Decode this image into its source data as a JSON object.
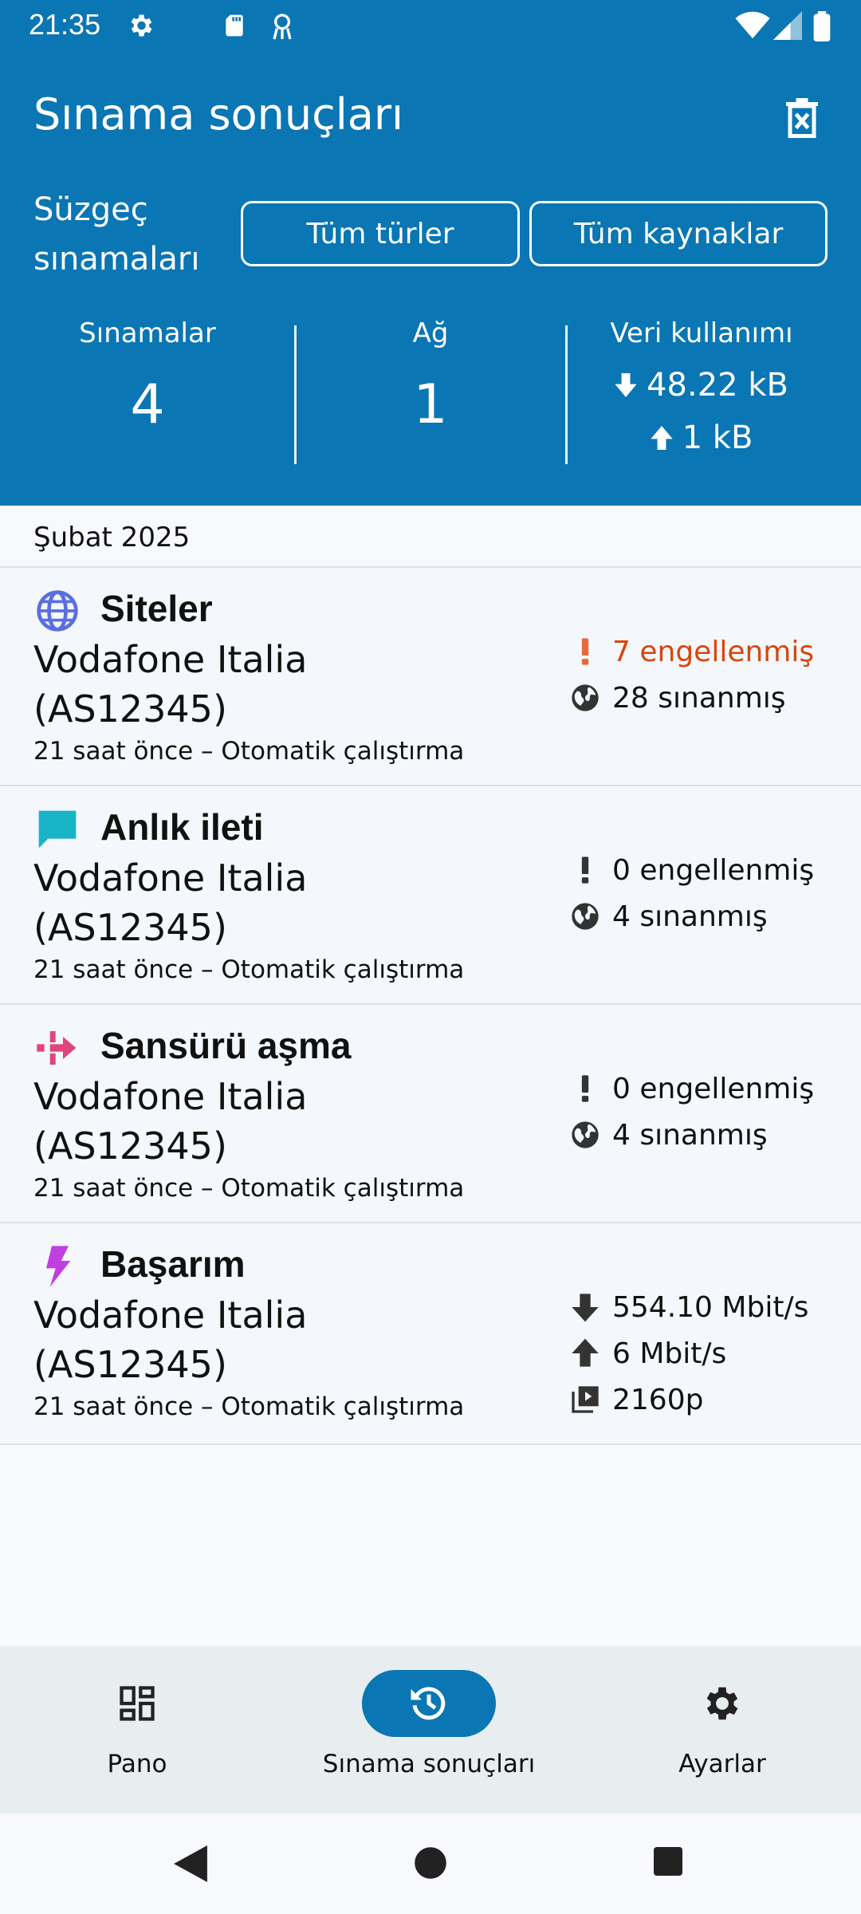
{
  "status_bar": {
    "time": "21:35"
  },
  "header": {
    "title": "Sınama sonuçları",
    "filter_label_line1": "Süzgeç",
    "filter_label_line2": "sınamaları",
    "filter_type_button": "Tüm türler",
    "filter_source_button": "Tüm kaynaklar"
  },
  "summary": {
    "tests_label": "Sınamalar",
    "tests_value": "4",
    "networks_label": "Ağ",
    "networks_value": "1",
    "data_usage_label": "Veri kullanımı",
    "download": "48.22 kB",
    "upload": "1 kB"
  },
  "list": {
    "month": "Şubat 2025",
    "items": [
      {
        "title": "Siteler",
        "network_line1": "Vodafone Italia",
        "network_line2": "(AS12345)",
        "time": "21 saat önce – Otomatik çalıştırma",
        "blocked": "7 engellenmiş",
        "tested": "28 sınanmış",
        "icon": "globe-icon",
        "icon_color": "#5b6ee0"
      },
      {
        "title": "Anlık ileti",
        "network_line1": "Vodafone Italia",
        "network_line2": "(AS12345)",
        "time": "21 saat önce – Otomatik çalıştırma",
        "blocked": "0 engellenmiş",
        "tested": "4 sınanmış",
        "icon": "chat-bubble-icon",
        "icon_color": "#19b3c7"
      },
      {
        "title": "Sansürü aşma",
        "network_line1": "Vodafone Italia",
        "network_line2": "(AS12345)",
        "time": "21 saat önce – Otomatik çalıştırma",
        "blocked": "0 engellenmiş",
        "tested": "4 sınanmış",
        "icon": "circumvention-icon",
        "icon_color": "#e0457b"
      },
      {
        "title": "Başarım",
        "network_line1": "Vodafone Italia",
        "network_line2": "(AS12345)",
        "time": "21 saat önce – Otomatik çalıştırma",
        "download": "554.10 Mbit/s",
        "upload": "6 Mbit/s",
        "video": "2160p",
        "icon": "lightning-icon",
        "icon_color": "#c13ee0"
      }
    ]
  },
  "bottom_nav": {
    "dashboard": "Pano",
    "results": "Sınama sonuçları",
    "settings": "Ayarlar"
  },
  "colors": {
    "header_bg": "#0a76b3",
    "blocked_red": "#d9460c"
  }
}
